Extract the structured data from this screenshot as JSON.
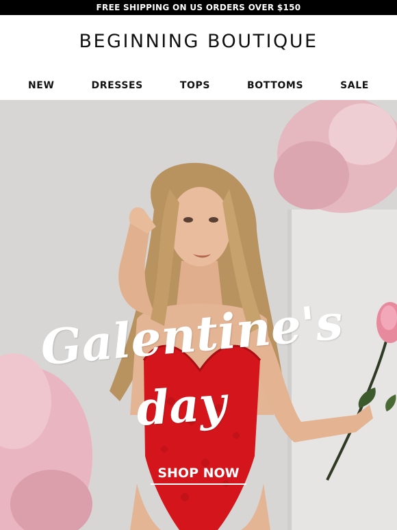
{
  "promo": {
    "text": "FREE SHIPPING ON US ORDERS OVER $150"
  },
  "brand": {
    "logo_text": "BEGINNING BOUTIQUE"
  },
  "nav": {
    "items": [
      {
        "label": "NEW"
      },
      {
        "label": "DRESSES"
      },
      {
        "label": "TOPS"
      },
      {
        "label": "BOTTOMS"
      },
      {
        "label": "SALE"
      }
    ]
  },
  "hero": {
    "headline_line1": "Galentine's",
    "headline_line2": "day",
    "cta_label": "SHOP NOW",
    "colors": {
      "bodysuit": "#d4161c",
      "rose": "#f2b8c6",
      "hair": "#b8925f",
      "skin": "#e4b594",
      "background": "#d6d5d4"
    }
  }
}
